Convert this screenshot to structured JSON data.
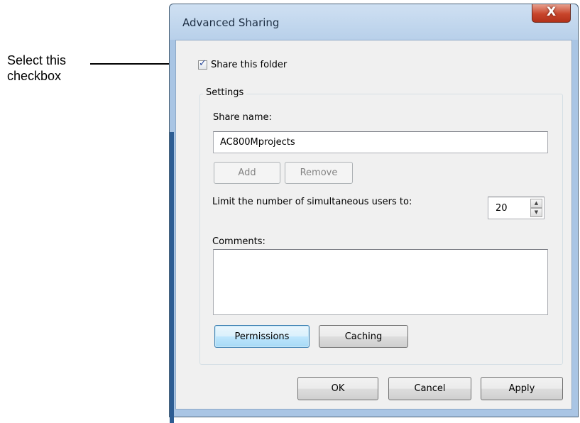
{
  "annotation": {
    "text": "Select this checkbox"
  },
  "window": {
    "title": "Advanced Sharing",
    "close_label": "X"
  },
  "share": {
    "checkbox_label": "Share this folder",
    "checked": true
  },
  "settings": {
    "group_title": "Settings",
    "share_name_label": "Share name:",
    "share_name_value": "AC800Mprojects",
    "add_label": "Add",
    "remove_label": "Remove",
    "limit_label": "Limit the number of simultaneous users to:",
    "limit_value": "20",
    "comments_label": "Comments:",
    "comments_value": "",
    "permissions_label": "Permissions",
    "caching_label": "Caching"
  },
  "footer": {
    "ok_label": "OK",
    "cancel_label": "Cancel",
    "apply_label": "Apply"
  },
  "icons": {
    "checkmark": "checkmark-icon",
    "close": "close-icon",
    "spin_up": "spin-up-icon",
    "spin_down": "spin-down-icon"
  }
}
